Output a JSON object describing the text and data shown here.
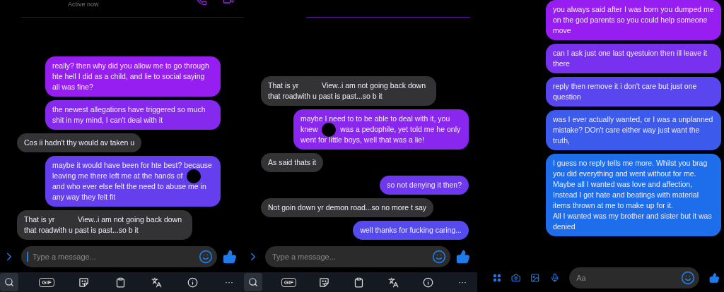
{
  "panels": [
    {
      "kind": "keyboard",
      "header": {
        "status": "Active now"
      },
      "messages": [
        {
          "kind": "sent",
          "segments": [
            {
              "kind": "text",
              "text": "really? then why did you allow me to go through hte hell I did as a child, and lie to social saying all was fine?"
            }
          ]
        },
        {
          "kind": "sent",
          "segments": [
            {
              "kind": "text",
              "text": "the newest allegations have triggered so much shit in my mind, I can't deal with it"
            }
          ]
        },
        {
          "kind": "received",
          "segments": [
            {
              "kind": "text",
              "text": "Cos ii hadn't thy would av taken u"
            }
          ]
        },
        {
          "kind": "sent",
          "segments": [
            {
              "kind": "text",
              "text": "maybe it would have been for hte best? because leaving me there left me at the hands of"
            },
            {
              "kind": "redaction"
            },
            {
              "kind": "text",
              "text": "and who ever else felt the need to abuse me in any way they felt fit"
            }
          ]
        },
        {
          "kind": "received",
          "segments": [
            {
              "kind": "text",
              "text": "That is yr"
            },
            {
              "kind": "blank"
            },
            {
              "kind": "text",
              "text": "View..i am not going back down that roadwith u past is past...so b it"
            }
          ]
        }
      ],
      "composer": {
        "placeholder": "Type a message...",
        "focused": true
      },
      "toolbar": [
        {
          "kind": "search"
        },
        {
          "kind": "gif",
          "label": "GIF"
        },
        {
          "kind": "sticker"
        },
        {
          "kind": "clipboard"
        },
        {
          "kind": "translate"
        },
        {
          "kind": "info"
        },
        {
          "kind": "more",
          "label": "···"
        }
      ]
    },
    {
      "kind": "keyboard",
      "messages": [
        {
          "kind": "received",
          "segments": [
            {
              "kind": "text",
              "text": "That is yr"
            },
            {
              "kind": "blank"
            },
            {
              "kind": "text",
              "text": "View..i am not going back down that roadwith u past is past...so b it"
            }
          ]
        },
        {
          "kind": "sent",
          "segments": [
            {
              "kind": "text",
              "text": "maybe I need to to be able to deal with it, you knew"
            },
            {
              "kind": "redaction"
            },
            {
              "kind": "text",
              "text": "was a pedophile, yet told me he only went for little boys, well that was a lie!"
            }
          ]
        },
        {
          "kind": "received",
          "segments": [
            {
              "kind": "text",
              "text": "As said thats it"
            }
          ]
        },
        {
          "kind": "sent",
          "segments": [
            {
              "kind": "text",
              "text": "so not denying it then?"
            }
          ]
        },
        {
          "kind": "received",
          "segments": [
            {
              "kind": "text",
              "text": "Not goin down yr demon road...so no more t say"
            }
          ]
        },
        {
          "kind": "sent",
          "segments": [
            {
              "kind": "text",
              "text": "well thanks for fucking caring..."
            }
          ]
        }
      ],
      "composer": {
        "placeholder": "Type a message..."
      },
      "toolbar": [
        {
          "kind": "search"
        },
        {
          "kind": "gif",
          "label": "GIF"
        },
        {
          "kind": "sticker"
        },
        {
          "kind": "clipboard"
        },
        {
          "kind": "translate"
        },
        {
          "kind": "info"
        },
        {
          "kind": "more",
          "label": "···"
        }
      ]
    },
    {
      "kind": "actions",
      "messages": [
        {
          "kind": "sent",
          "segments": [
            {
              "kind": "text",
              "text": "you always said after I was born you dumped me on the god parents so you could help someone move"
            }
          ]
        },
        {
          "kind": "sent",
          "segments": [
            {
              "kind": "text",
              "text": "can I ask just one last qyestuion then ill leave it there"
            }
          ]
        },
        {
          "kind": "sent",
          "segments": [
            {
              "kind": "text",
              "text": "reply then remove it i don't care but just one question"
            }
          ]
        },
        {
          "kind": "sent",
          "segments": [
            {
              "kind": "text",
              "text": "was I ever actually wanted, or I was a unplanned mistake? DOn't care either way just want the truth,"
            }
          ]
        },
        {
          "kind": "sent",
          "segments": [
            {
              "kind": "text",
              "text": "I guess no reply tells me more. Whilst you brag you did everything and went without for me. Maybe all I wanted was love and affection, Instead I got hate and beatings with material items thrown at me to make up for it.\nAll I wanted was my brother and sister but it was denied"
            }
          ]
        }
      ],
      "composer": {
        "placeholder": "Aa"
      }
    }
  ]
}
